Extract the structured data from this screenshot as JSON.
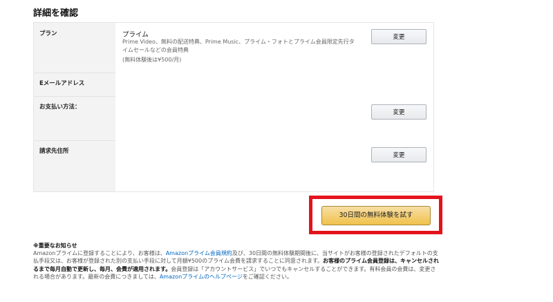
{
  "page": {
    "title": "詳細を確認"
  },
  "rows": {
    "plan": {
      "label": "プラン",
      "name": "プライム",
      "desc": "Prime Video、無料の配送特典、Prime Music、プライム・フォトとプライム会員限定先行タイムセールなどの会員特典",
      "note": "(無料体験後は¥500/月)",
      "change_label": "変更"
    },
    "email": {
      "label": "Eメールアドレス"
    },
    "payment": {
      "label": "お支払い方法：",
      "change_label": "変更"
    },
    "billing": {
      "label": "請求先住所",
      "change_label": "変更"
    }
  },
  "cta": {
    "label": "30日間の無料体験を試す",
    "highlight_color": "#e3131b"
  },
  "notice": {
    "title": "※重要なお知らせ",
    "p1": "Amazonプライムに登録することにより、お客様は、",
    "link_terms": "Amazonプライム会員規約",
    "p2": "及び、30日間の無料体験期間後に、当サイトがお客様の登録されたデフォルトの支払手段又は、お客様が登録された別の支払い手段に対して月額¥500のプライム会費を請求することに同意されます。",
    "bold": "お客様のプライム会員登録は、キャンセルされるまで毎月自動で更新し、毎月、会費が適用されます。",
    "p3": "会員登録は「アカウントサービス」でいつでもキャンセルすることができます。有料会員の会費は、変更される場合があります。最新の会費につきましては、",
    "link_help": "Amazonプライムのヘルプページ",
    "p4": "をご確認ください。"
  }
}
